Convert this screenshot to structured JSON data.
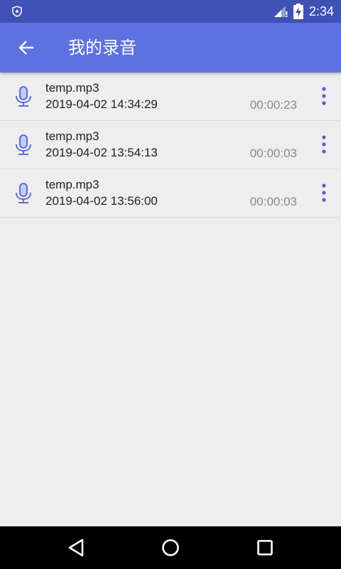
{
  "status_bar": {
    "time": "2:34"
  },
  "app_bar": {
    "title": "我的录音"
  },
  "recordings": [
    {
      "name": "temp.mp3",
      "date": "2019-04-02 14:34:29",
      "duration": "00:00:23"
    },
    {
      "name": "temp.mp3",
      "date": "2019-04-02 13:54:13",
      "duration": "00:00:03"
    },
    {
      "name": "temp.mp3",
      "date": "2019-04-02 13:56:00",
      "duration": "00:00:03"
    }
  ],
  "colors": {
    "status_bar": "#3f51b5",
    "app_bar": "#5d72e0",
    "accent_icon": "#5060d8",
    "background": "#eeeeee"
  },
  "icons": {
    "back": "arrow-back-icon",
    "item": "microphone-icon",
    "menu": "more-vert-icon"
  }
}
